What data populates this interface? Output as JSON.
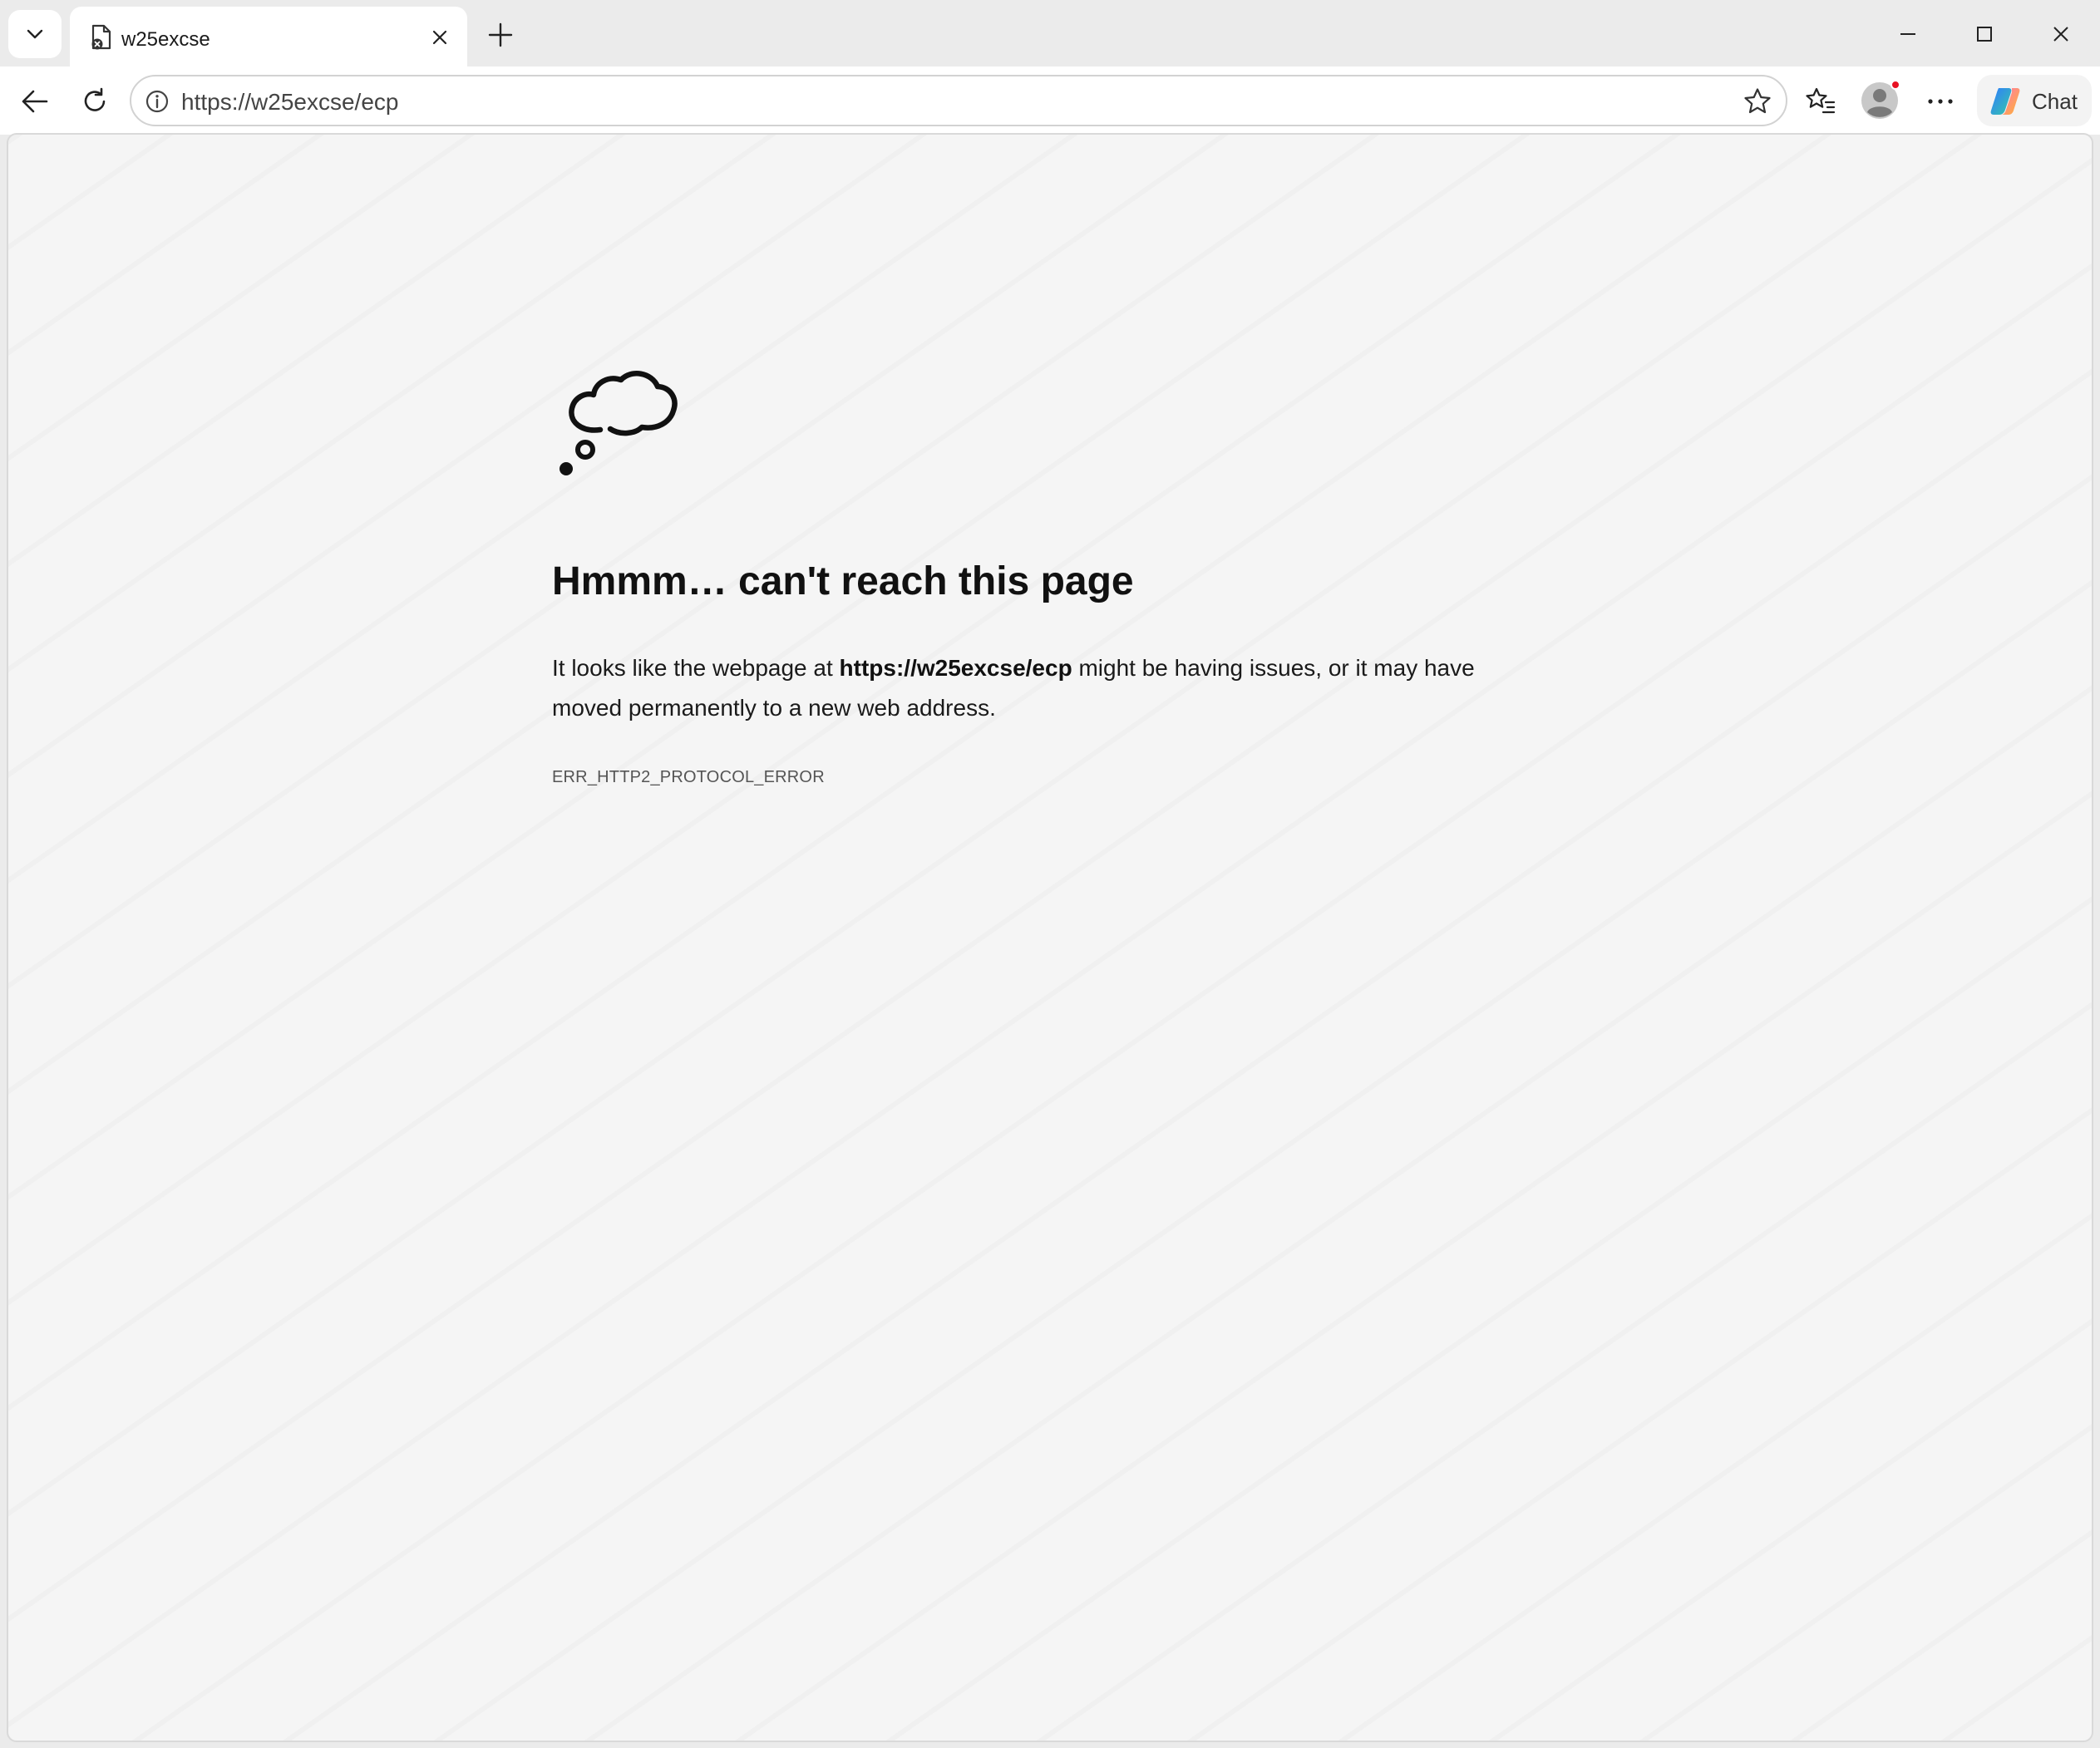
{
  "tab": {
    "title": "w25excse"
  },
  "toolbar": {
    "url": "https://w25excse/ecp",
    "chat_label": "Chat"
  },
  "error_page": {
    "heading": "Hmmm… can't reach this page",
    "desc_prefix": "It looks like the webpage at ",
    "desc_url": "https://w25excse/ecp",
    "desc_suffix": " might be having issues, or it may have moved permanently to a new web address.",
    "error_code": "ERR_HTTP2_PROTOCOL_ERROR"
  },
  "icons": {
    "tab_menu": "chevron-down-icon",
    "favicon": "broken-page-icon",
    "tab_close": "close-icon",
    "new_tab": "plus-icon",
    "minimize": "minimize-icon",
    "maximize": "maximize-icon",
    "close_window": "close-icon",
    "back": "arrow-left-icon",
    "refresh": "refresh-icon",
    "site_info": "info-icon",
    "favorite": "star-icon",
    "favorites_list": "favorites-icon",
    "profile": "avatar-icon",
    "more": "more-dots-icon",
    "copilot": "copilot-logo-icon",
    "error": "thought-bubble-icon"
  },
  "colors": {
    "content_background": "#f5f5f5",
    "chrome_background": "#ebebeb",
    "notification_dot": "#e81123"
  }
}
